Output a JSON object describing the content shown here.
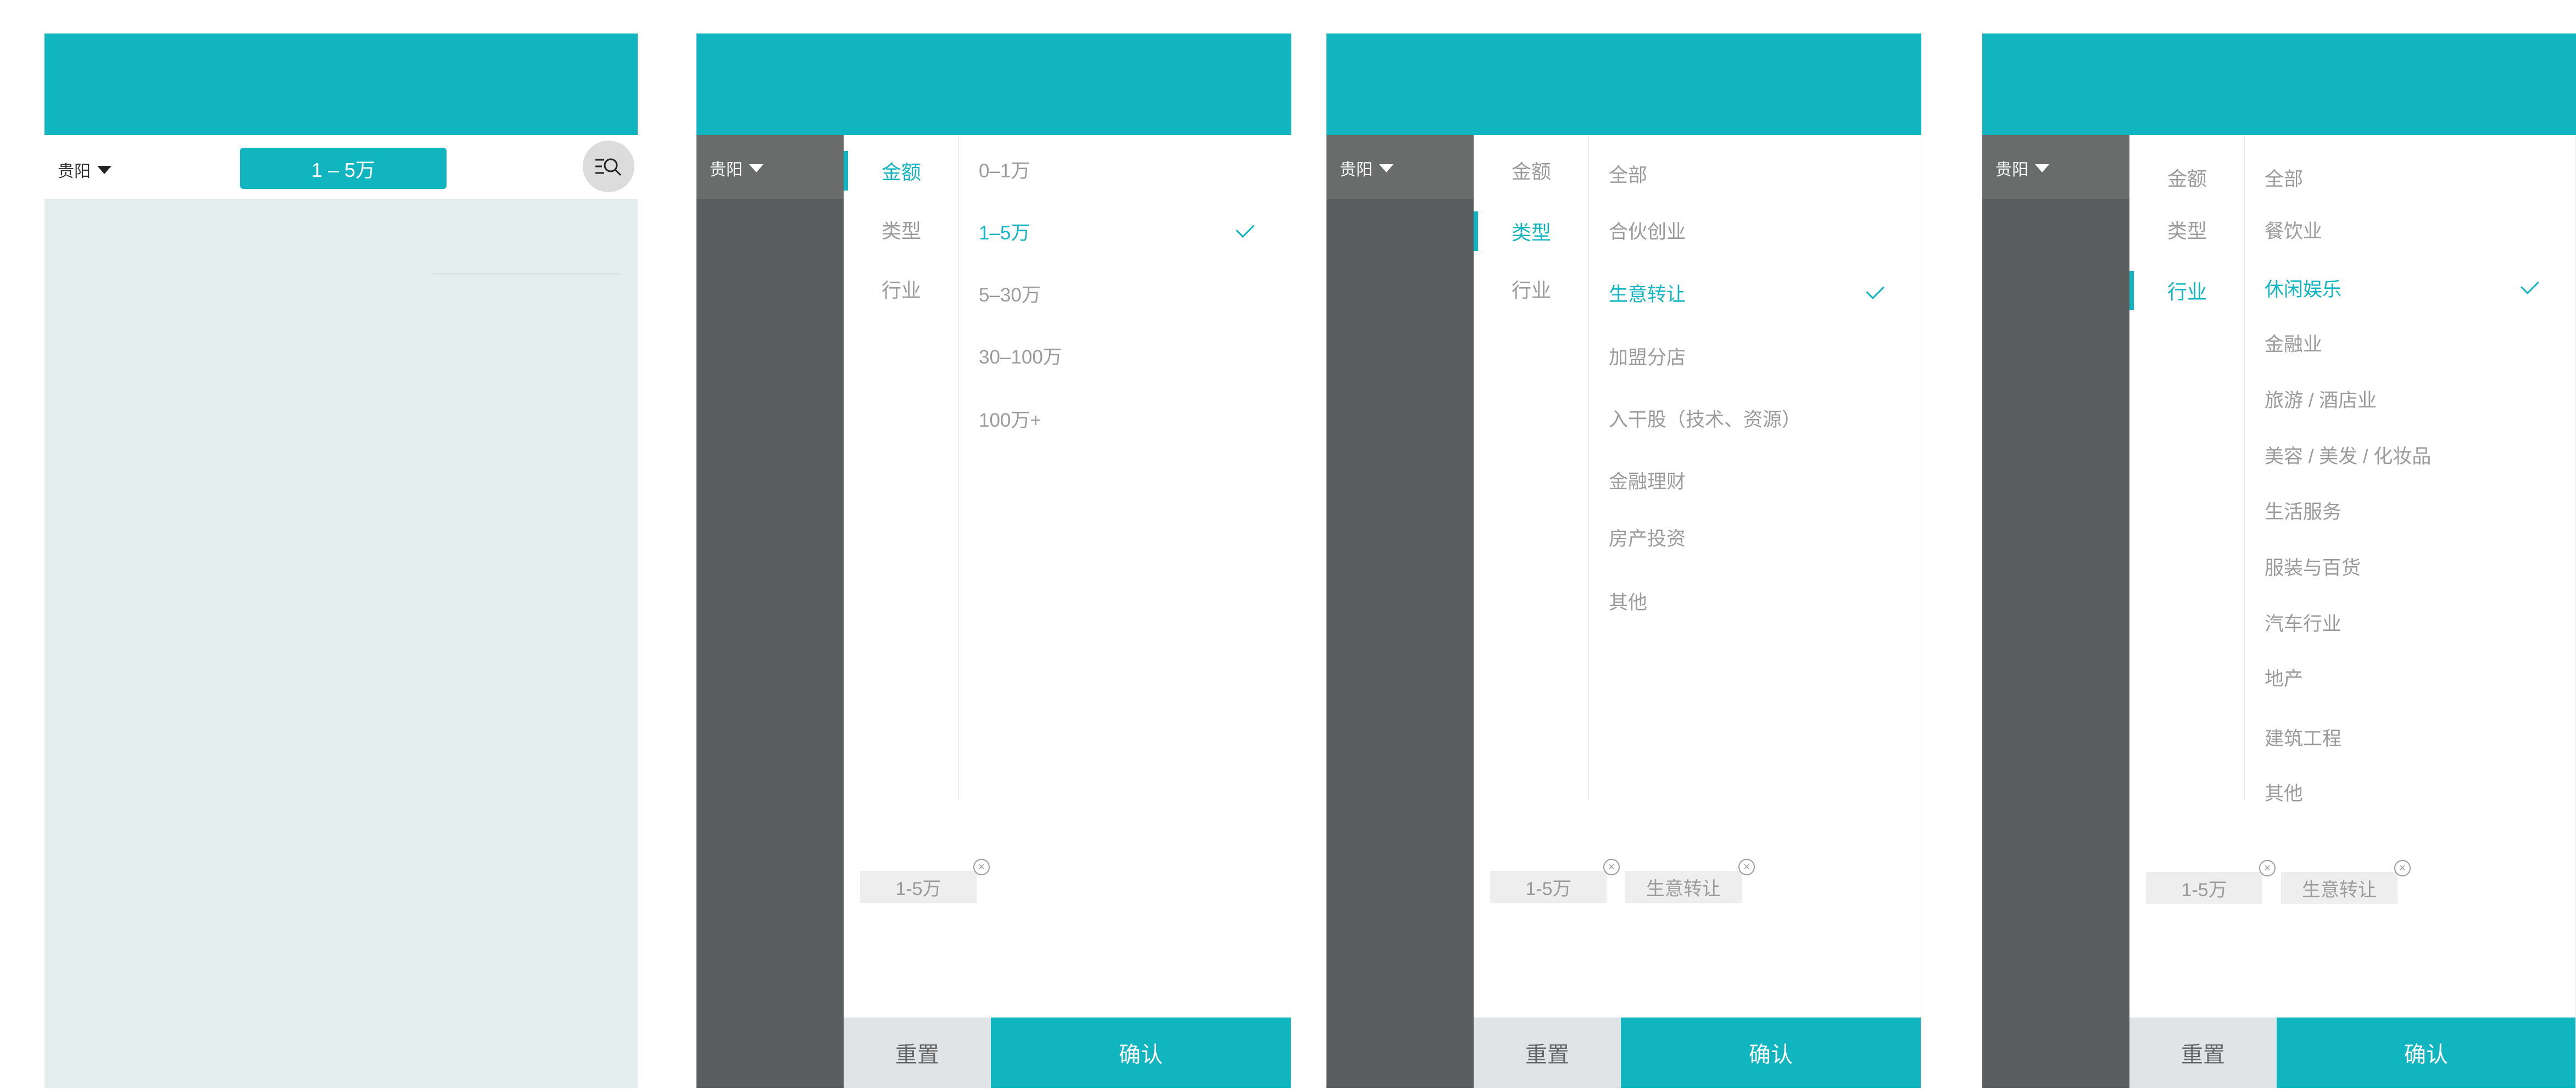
{
  "colors": {
    "accent": "#11b5bf",
    "overlay": "#5b5e5e",
    "list_bg": "#e4eeec"
  },
  "screen1": {
    "city": "贵阳",
    "amount_chip": "1 – 5万",
    "search_icon": "filter-search-icon"
  },
  "screen2": {
    "city": "贵阳",
    "categories": [
      "金额",
      "类型",
      "行业"
    ],
    "active_category": "金额",
    "options": [
      "0–1万",
      "1–5万",
      "5–30万",
      "30–100万",
      "100万+"
    ],
    "selected_option": "1–5万",
    "tags": [
      "1-5万"
    ],
    "reset": "重置",
    "confirm": "确认"
  },
  "screen3": {
    "city": "贵阳",
    "categories": [
      "金额",
      "类型",
      "行业"
    ],
    "active_category": "类型",
    "options": [
      "全部",
      "合伙创业",
      "生意转让",
      "加盟分店",
      "入干股（技术、资源）",
      "金融理财",
      "房产投资",
      "其他"
    ],
    "selected_option": "生意转让",
    "tags": [
      "1-5万",
      "生意转让"
    ],
    "reset": "重置",
    "confirm": "确认"
  },
  "screen4": {
    "city": "贵阳",
    "categories": [
      "金额",
      "类型",
      "行业"
    ],
    "active_category": "行业",
    "options": [
      "全部",
      "餐饮业",
      "休闲娱乐",
      "金融业",
      "旅游 / 酒店业",
      "美容 / 美发 / 化妆品",
      "生活服务",
      "服装与百货",
      "汽车行业",
      "地产",
      "建筑工程",
      "其他"
    ],
    "selected_option": "休闲娱乐",
    "tags": [
      "1-5万",
      "生意转让"
    ],
    "reset": "重置",
    "confirm": "确认"
  }
}
